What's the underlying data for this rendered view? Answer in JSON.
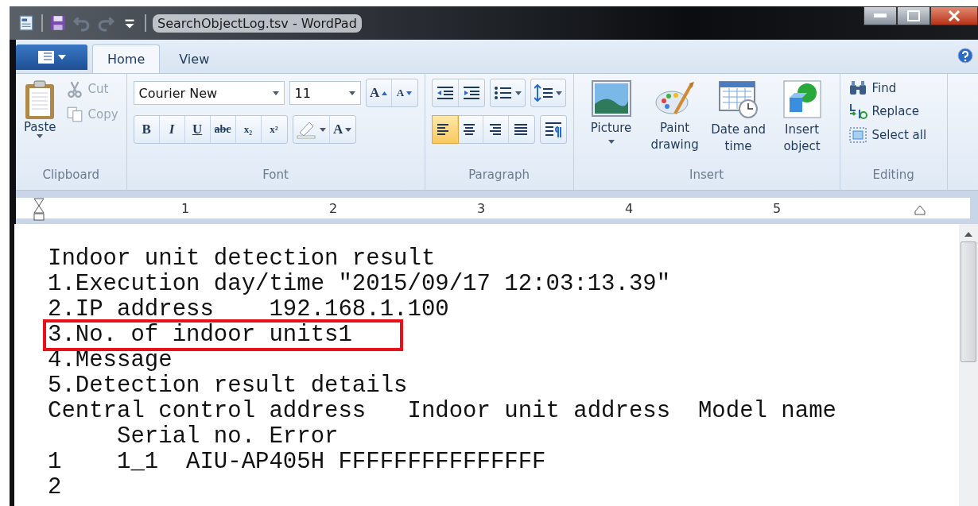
{
  "window": {
    "title": "SearchObjectLog.tsv - WordPad"
  },
  "quick_access": [
    {
      "kind": "save",
      "disabled": false
    },
    {
      "kind": "undo",
      "disabled": true
    },
    {
      "kind": "redo",
      "disabled": true
    },
    {
      "kind": "customize",
      "disabled": false
    }
  ],
  "tabs": [
    {
      "label": "Home",
      "selected": true
    },
    {
      "label": "View",
      "selected": false
    }
  ],
  "ribbon": {
    "clipboard": {
      "label": "Clipboard",
      "paste": "Paste",
      "items": [
        {
          "kind": "cut",
          "label": "Cut",
          "disabled": true
        },
        {
          "kind": "copy",
          "label": "Copy",
          "disabled": true
        }
      ]
    },
    "font": {
      "label": "Font",
      "font_name": "Courier New",
      "font_size": "11",
      "size_buttons": [
        {
          "kind": "grow",
          "label": "A"
        },
        {
          "kind": "shrink",
          "label": "A"
        }
      ],
      "format_buttons": [
        {
          "kind": "bold",
          "label": "B"
        },
        {
          "kind": "italic",
          "label": "I"
        },
        {
          "kind": "underline",
          "label": "U"
        },
        {
          "kind": "strike",
          "label": "abc"
        },
        {
          "kind": "sub",
          "label": "x₂"
        },
        {
          "kind": "sup",
          "label": "x²"
        }
      ],
      "color_button": "A"
    },
    "paragraph": {
      "label": "Paragraph",
      "alignments": [
        {
          "kind": "left",
          "selected": true
        },
        {
          "kind": "center",
          "selected": false
        },
        {
          "kind": "right",
          "selected": false
        },
        {
          "kind": "justify",
          "selected": false
        }
      ]
    },
    "insert": {
      "label": "Insert",
      "items": [
        {
          "kind": "picture",
          "label": "Picture",
          "dropdown": true
        },
        {
          "kind": "paint",
          "label": "Paint drawing",
          "dropdown": false
        },
        {
          "kind": "datetime",
          "label": "Date and time",
          "dropdown": false
        },
        {
          "kind": "object",
          "label": "Insert object",
          "dropdown": false
        }
      ]
    },
    "editing": {
      "label": "Editing",
      "items": [
        {
          "kind": "find",
          "label": "Find"
        },
        {
          "kind": "replace",
          "label": "Replace"
        },
        {
          "kind": "selectall",
          "label": "Select all"
        }
      ]
    }
  },
  "ruler": {
    "numbers": [
      "1",
      "2",
      "3",
      "4",
      "5"
    ]
  },
  "document": {
    "lines": [
      {
        "text": "Indoor unit detection result",
        "highlighted": false
      },
      {
        "text": "1.Execution day/time \"2015/09/17 12:03:13.39\"",
        "highlighted": false
      },
      {
        "text": "2.IP address    192.168.1.100",
        "highlighted": false
      },
      {
        "text": "3.No. of indoor units1",
        "highlighted": true
      },
      {
        "text": "4.Message",
        "highlighted": false
      },
      {
        "text": "5.Detection result details",
        "highlighted": false
      },
      {
        "text": "Central control address   Indoor unit address  Model name",
        "highlighted": false
      },
      {
        "text": "     Serial no. Error",
        "highlighted": false
      },
      {
        "text": "1    1_1  AIU-AP405H FFFFFFFFFFFFFFF",
        "highlighted": false
      },
      {
        "text": "2",
        "highlighted": false
      }
    ]
  }
}
